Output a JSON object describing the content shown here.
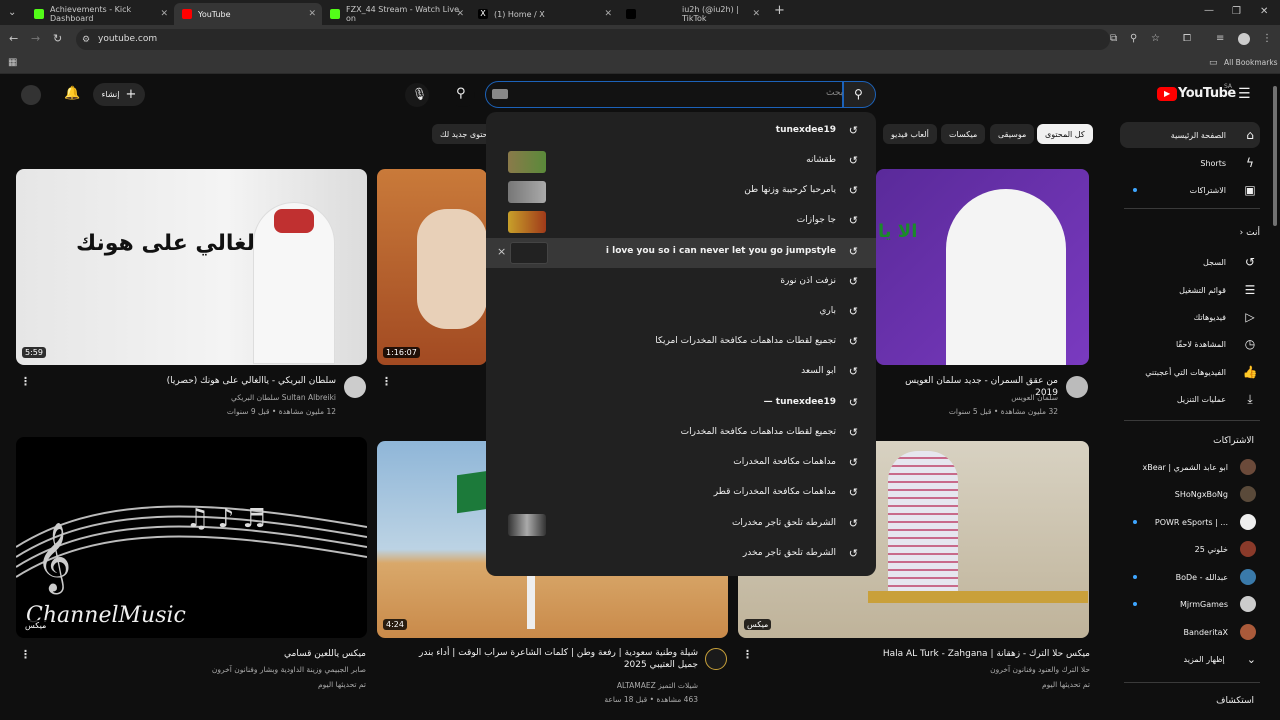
{
  "browser": {
    "tabs": [
      {
        "label": "Achievements - Kick Dashboard",
        "color": "#53fc18"
      },
      {
        "label": "YouTube",
        "color": "#ff0000"
      },
      {
        "label": "FZX_44 Stream - Watch Live on",
        "color": "#53fc18"
      },
      {
        "label": "(1) Home / X",
        "color": "#000000"
      },
      {
        "label": "iu2h (@iu2h) | TikTok",
        "color": "#000000"
      }
    ],
    "url": "youtube.com",
    "bookmarks_label": "All Bookmarks"
  },
  "youtube": {
    "logo_text": "YouTube",
    "region": "SA",
    "search_placeholder": "بحث",
    "create_label": "إنشاء",
    "chips": [
      "كل المحتوى",
      "موسيقى",
      "ميكسات",
      "ألعاب فيديو",
      "محتوى جديد لك"
    ],
    "suggestions": [
      {
        "text": "tunexdee19"
      },
      {
        "text": "طقشانه"
      },
      {
        "text": "يامرحبا كرحيبة وزنها طن"
      },
      {
        "text": "جا جوازات"
      },
      {
        "text": "i love you so i can never let you go jumpstyle",
        "remove": "×"
      },
      {
        "text": "نزفت اذن نورة"
      },
      {
        "text": "باري"
      },
      {
        "text": "تجميع لقطات مداهمات مكافحة المخدرات امريكا"
      },
      {
        "text": "ابو السعد"
      },
      {
        "text": "tunexdee19 —"
      },
      {
        "text": "تجميع لقطات مداهمات مكافحة المخدرات"
      },
      {
        "text": "مداهمات مكافحة المخدرات"
      },
      {
        "text": "مداهمات مكافحة المخدرات قطر"
      },
      {
        "text": "الشرطه تلحق تاجر مخدرات"
      },
      {
        "text": "الشرطه تلحق تاجر مخدر"
      }
    ],
    "sidebar": {
      "main": [
        {
          "label": "الصفحة الرئيسية",
          "icon": "home-icon"
        },
        {
          "label": "Shorts",
          "icon": "shorts-icon"
        },
        {
          "label": "الاشتراكات",
          "icon": "subscriptions-icon"
        }
      ],
      "you_heading": "أنت",
      "you": [
        {
          "label": "السجل",
          "icon": "history-icon"
        },
        {
          "label": "قوائم التشغيل",
          "icon": "playlists-icon"
        },
        {
          "label": "فيديوهاتك",
          "icon": "your-videos-icon"
        },
        {
          "label": "المشاهدة لاحقًا",
          "icon": "watch-later-icon"
        },
        {
          "label": "الفيديوهات التي أعجبتني",
          "icon": "liked-icon"
        },
        {
          "label": "عمليات التنزيل",
          "icon": "download-icon"
        }
      ],
      "subs_heading": "الاشتراكات",
      "subs": [
        {
          "label": "xBear | ابو عابد الشمري",
          "color": "#6b4a3a"
        },
        {
          "label": "SHoNgxBoNg",
          "color": "#5a4a3a"
        },
        {
          "label": "POWR eSports | ...",
          "color": "#eeeeee"
        },
        {
          "label": "خلوني 25",
          "color": "#8a3a2a"
        },
        {
          "label": "BoDe - عبدالله",
          "color": "#3a7aaa"
        },
        {
          "label": "MjrmGames",
          "color": "#cccccc"
        },
        {
          "label": "BanderitaX",
          "color": "#aa5a3a"
        }
      ],
      "show_more": "إظهار المزيد",
      "explore": "استكشاف"
    },
    "videos": [
      {
        "title": "سلطان البريكي - ياالغالي على هونك (حصريا)",
        "channel": "Sultan Albreiki سلطان البريكي",
        "meta": "12 مليون مشاهدة • قبل 9 سنوات",
        "duration": "5:59",
        "thumb_text": "ياالغالي على هونك"
      },
      {
        "title": "",
        "channel": "",
        "meta": "",
        "duration": "1:16:07"
      },
      {
        "title": "من عقق السمران - جديد سلمان العويس 2019",
        "channel": "سلمان العويس",
        "meta": "32 مليون مشاهدة • قبل 5 سنوات",
        "duration": "",
        "thumb_text": "الا يا"
      },
      {
        "title": "ميكس ياللعين قسامي",
        "channel": "صابر الجبيمي وزينة الداودية وبشار وفنانون آخرون",
        "meta": "تم تحديثها اليوم",
        "duration": "ميكس",
        "thumb_text": "ChannelMusic"
      },
      {
        "title": "شيلة وطنية سعودية | رفعة وطن | كلمات الشاعرة سراب الوقت | أداء بندر جميل العتيبي 2025",
        "channel": "شيلات التميز ALTAMAEZ",
        "meta": "463 مشاهدة • قبل 18 ساعة",
        "duration": "4:24"
      },
      {
        "title": "ميكس حلا الترك - زهقانة | Hala AL Turk - Zahgana",
        "channel": "حلا الترك والعنود وفنانون آخرون",
        "meta": "تم تحديثها اليوم",
        "duration": "ميكس"
      }
    ]
  }
}
